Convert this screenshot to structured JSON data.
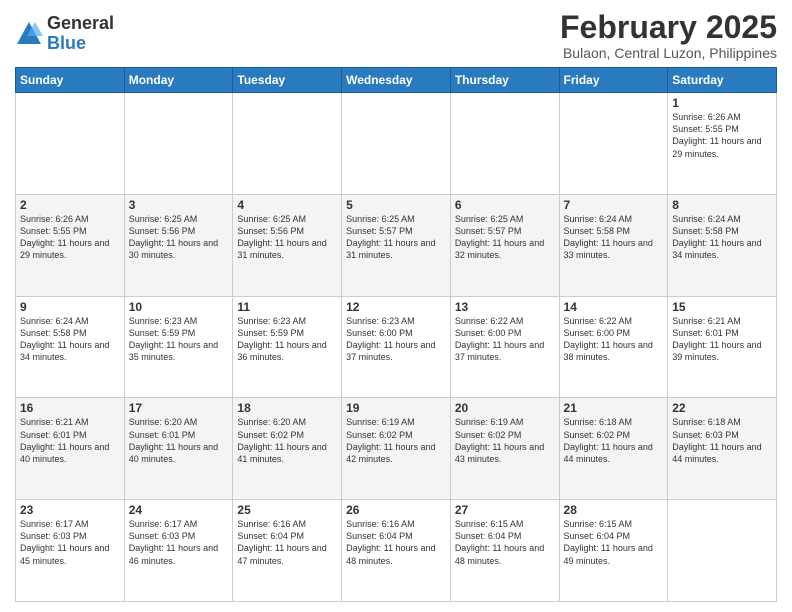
{
  "logo": {
    "general": "General",
    "blue": "Blue"
  },
  "title": "February 2025",
  "location": "Bulaon, Central Luzon, Philippines",
  "days_of_week": [
    "Sunday",
    "Monday",
    "Tuesday",
    "Wednesday",
    "Thursday",
    "Friday",
    "Saturday"
  ],
  "weeks": [
    [
      {
        "day": "",
        "info": ""
      },
      {
        "day": "",
        "info": ""
      },
      {
        "day": "",
        "info": ""
      },
      {
        "day": "",
        "info": ""
      },
      {
        "day": "",
        "info": ""
      },
      {
        "day": "",
        "info": ""
      },
      {
        "day": "1",
        "info": "Sunrise: 6:26 AM\nSunset: 5:55 PM\nDaylight: 11 hours and 29 minutes."
      }
    ],
    [
      {
        "day": "2",
        "info": "Sunrise: 6:26 AM\nSunset: 5:55 PM\nDaylight: 11 hours and 29 minutes."
      },
      {
        "day": "3",
        "info": "Sunrise: 6:25 AM\nSunset: 5:56 PM\nDaylight: 11 hours and 30 minutes."
      },
      {
        "day": "4",
        "info": "Sunrise: 6:25 AM\nSunset: 5:56 PM\nDaylight: 11 hours and 31 minutes."
      },
      {
        "day": "5",
        "info": "Sunrise: 6:25 AM\nSunset: 5:57 PM\nDaylight: 11 hours and 31 minutes."
      },
      {
        "day": "6",
        "info": "Sunrise: 6:25 AM\nSunset: 5:57 PM\nDaylight: 11 hours and 32 minutes."
      },
      {
        "day": "7",
        "info": "Sunrise: 6:24 AM\nSunset: 5:58 PM\nDaylight: 11 hours and 33 minutes."
      },
      {
        "day": "8",
        "info": "Sunrise: 6:24 AM\nSunset: 5:58 PM\nDaylight: 11 hours and 34 minutes."
      }
    ],
    [
      {
        "day": "9",
        "info": "Sunrise: 6:24 AM\nSunset: 5:58 PM\nDaylight: 11 hours and 34 minutes."
      },
      {
        "day": "10",
        "info": "Sunrise: 6:23 AM\nSunset: 5:59 PM\nDaylight: 11 hours and 35 minutes."
      },
      {
        "day": "11",
        "info": "Sunrise: 6:23 AM\nSunset: 5:59 PM\nDaylight: 11 hours and 36 minutes."
      },
      {
        "day": "12",
        "info": "Sunrise: 6:23 AM\nSunset: 6:00 PM\nDaylight: 11 hours and 37 minutes."
      },
      {
        "day": "13",
        "info": "Sunrise: 6:22 AM\nSunset: 6:00 PM\nDaylight: 11 hours and 37 minutes."
      },
      {
        "day": "14",
        "info": "Sunrise: 6:22 AM\nSunset: 6:00 PM\nDaylight: 11 hours and 38 minutes."
      },
      {
        "day": "15",
        "info": "Sunrise: 6:21 AM\nSunset: 6:01 PM\nDaylight: 11 hours and 39 minutes."
      }
    ],
    [
      {
        "day": "16",
        "info": "Sunrise: 6:21 AM\nSunset: 6:01 PM\nDaylight: 11 hours and 40 minutes."
      },
      {
        "day": "17",
        "info": "Sunrise: 6:20 AM\nSunset: 6:01 PM\nDaylight: 11 hours and 40 minutes."
      },
      {
        "day": "18",
        "info": "Sunrise: 6:20 AM\nSunset: 6:02 PM\nDaylight: 11 hours and 41 minutes."
      },
      {
        "day": "19",
        "info": "Sunrise: 6:19 AM\nSunset: 6:02 PM\nDaylight: 11 hours and 42 minutes."
      },
      {
        "day": "20",
        "info": "Sunrise: 6:19 AM\nSunset: 6:02 PM\nDaylight: 11 hours and 43 minutes."
      },
      {
        "day": "21",
        "info": "Sunrise: 6:18 AM\nSunset: 6:02 PM\nDaylight: 11 hours and 44 minutes."
      },
      {
        "day": "22",
        "info": "Sunrise: 6:18 AM\nSunset: 6:03 PM\nDaylight: 11 hours and 44 minutes."
      }
    ],
    [
      {
        "day": "23",
        "info": "Sunrise: 6:17 AM\nSunset: 6:03 PM\nDaylight: 11 hours and 45 minutes."
      },
      {
        "day": "24",
        "info": "Sunrise: 6:17 AM\nSunset: 6:03 PM\nDaylight: 11 hours and 46 minutes."
      },
      {
        "day": "25",
        "info": "Sunrise: 6:16 AM\nSunset: 6:04 PM\nDaylight: 11 hours and 47 minutes."
      },
      {
        "day": "26",
        "info": "Sunrise: 6:16 AM\nSunset: 6:04 PM\nDaylight: 11 hours and 48 minutes."
      },
      {
        "day": "27",
        "info": "Sunrise: 6:15 AM\nSunset: 6:04 PM\nDaylight: 11 hours and 48 minutes."
      },
      {
        "day": "28",
        "info": "Sunrise: 6:15 AM\nSunset: 6:04 PM\nDaylight: 11 hours and 49 minutes."
      },
      {
        "day": "",
        "info": ""
      }
    ]
  ]
}
